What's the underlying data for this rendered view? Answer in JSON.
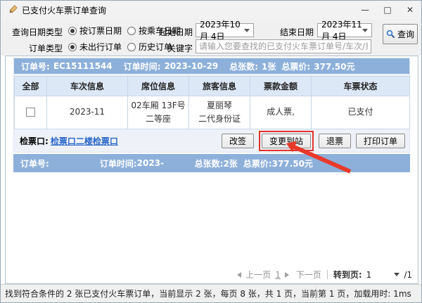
{
  "window": {
    "title": "已支付火车票订单查询",
    "minimize": "—",
    "maximize": "□",
    "close": "✕"
  },
  "form": {
    "date_type_label": "查询日期类型",
    "date_type_options": [
      {
        "label": "按订票日期",
        "selected": true
      },
      {
        "label": "按乘车日期",
        "selected": false
      }
    ],
    "order_type_label": "订单类型",
    "order_type_options": [
      {
        "label": "未出行订单",
        "selected": true
      },
      {
        "label": "历史订单",
        "selected": false
      }
    ],
    "start_date_label": "起始日期",
    "start_date_value": "2023年10月 4日",
    "end_date_label": "结束日期",
    "end_date_value": "2023年11月 4日",
    "keyword_label": "关键字",
    "keyword_placeholder": "请输入您要查找的已支付火车票订单号/车次/乘客姓名",
    "search_label": "查询"
  },
  "order1": {
    "no_label": "订单号:",
    "no": "EC15111544",
    "time_label": "订单时间:",
    "time": "2023-10-29",
    "count_label": "总张数:",
    "count": "1张",
    "price_label": "总票价:",
    "price": "377.50元",
    "columns": [
      "全部",
      "车次信息",
      "席位信息",
      "旅客信息",
      "票款金额",
      "车票状态"
    ],
    "row": {
      "checked": false,
      "train": "2023-11",
      "seat1": "02车厢 13F号",
      "seat2": "二等座",
      "passenger1": "夏丽琴",
      "passenger2": "二代身份证",
      "fare": "成人票,",
      "status": "已支付"
    },
    "gate_label": "检票口:",
    "gate_link": "检票口二楼检票口",
    "buttons": {
      "rebook": "改签",
      "change_dest": "变更到站",
      "refund": "退票",
      "print": "打印订单"
    }
  },
  "order2": {
    "no_label": "订单号:",
    "no": "",
    "time_label": "订单时间:",
    "time": "2023-",
    "count_label": "总张数:",
    "count": "2张",
    "price_label": "总票价:",
    "price": "377.50元"
  },
  "pagination": {
    "prev": "上一页",
    "current": "1",
    "next": "下一页",
    "goto_label": "转到页:",
    "goto_value": "1",
    "page_total": "/1"
  },
  "status": "找到符合条件的 2 张已支付火车票订单，当前显示 2 张，每页 8 张，共 1 页，当前第 1 页，加载用时: 1ms",
  "colors": {
    "bar_blue": "#8db0da",
    "highlight_red": "#e2332a",
    "link_blue": "#2a66c8"
  }
}
